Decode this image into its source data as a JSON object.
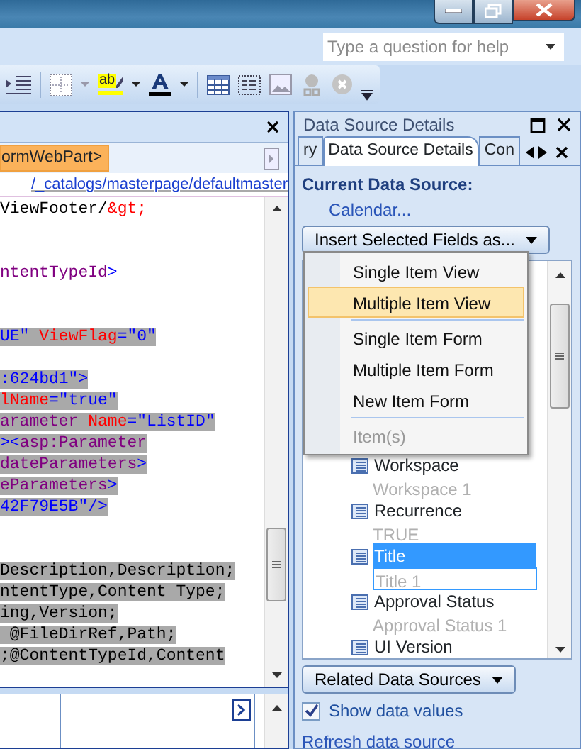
{
  "help_search": {
    "placeholder": "Type a question for help"
  },
  "toolbar": {
    "highlight_glyph": "ab"
  },
  "editor": {
    "tag_selector": "ormWebPart>",
    "path": "/_catalogs/masterpage/defaultmaster",
    "code_lines": [
      {
        "kind": "code",
        "highlighted": false,
        "tokens": [
          {
            "kind": "text",
            "text": "ViewFooter/"
          },
          {
            "kind": "entity",
            "text": "&gt;"
          }
        ]
      },
      {
        "kind": "blank"
      },
      {
        "kind": "blank"
      },
      {
        "kind": "code",
        "highlighted": false,
        "tokens": [
          {
            "kind": "element",
            "text": "ntentTypeId"
          },
          {
            "kind": "tag",
            "text": ">"
          }
        ]
      },
      {
        "kind": "blank"
      },
      {
        "kind": "blank"
      },
      {
        "kind": "code",
        "highlighted": true,
        "tokens": [
          {
            "kind": "value",
            "text": "UE\" "
          },
          {
            "kind": "attr",
            "text": "ViewFlag"
          },
          {
            "kind": "tag",
            "text": "="
          },
          {
            "kind": "value",
            "text": "\"0\""
          }
        ]
      },
      {
        "kind": "blank"
      },
      {
        "kind": "code",
        "highlighted": true,
        "tokens": [
          {
            "kind": "value",
            "text": ":624bd1\">"
          }
        ]
      },
      {
        "kind": "code",
        "highlighted": true,
        "tokens": [
          {
            "kind": "attr",
            "text": "lName"
          },
          {
            "kind": "tag",
            "text": "="
          },
          {
            "kind": "value",
            "text": "\"true\""
          }
        ]
      },
      {
        "kind": "code",
        "highlighted": true,
        "tokens": [
          {
            "kind": "element",
            "text": "arameter "
          },
          {
            "kind": "attr",
            "text": "Name"
          },
          {
            "kind": "tag",
            "text": "="
          },
          {
            "kind": "value",
            "text": "\"ListID\""
          }
        ]
      },
      {
        "kind": "code",
        "highlighted": true,
        "tokens": [
          {
            "kind": "tag",
            "text": "><"
          },
          {
            "kind": "element",
            "text": "asp:Parameter"
          }
        ]
      },
      {
        "kind": "code",
        "highlighted": true,
        "tokens": [
          {
            "kind": "element",
            "text": "dateParameters"
          },
          {
            "kind": "tag",
            "text": ">"
          }
        ]
      },
      {
        "kind": "code",
        "highlighted": true,
        "tokens": [
          {
            "kind": "element",
            "text": "eParameters"
          },
          {
            "kind": "tag",
            "text": ">"
          }
        ]
      },
      {
        "kind": "code",
        "highlighted": true,
        "tokens": [
          {
            "kind": "value",
            "text": "42F79E5B\""
          },
          {
            "kind": "tag",
            "text": "/>"
          }
        ]
      },
      {
        "kind": "blank"
      },
      {
        "kind": "blank"
      },
      {
        "kind": "code",
        "highlighted": true,
        "tokens": [
          {
            "kind": "text",
            "text": "Description,Description;"
          }
        ]
      },
      {
        "kind": "code",
        "highlighted": true,
        "tokens": [
          {
            "kind": "text",
            "text": "ntentType,Content Type;"
          }
        ]
      },
      {
        "kind": "code",
        "highlighted": true,
        "tokens": [
          {
            "kind": "text",
            "text": "ing,Version;"
          }
        ]
      },
      {
        "kind": "code",
        "highlighted": true,
        "tokens": [
          {
            "kind": "text",
            "text": " @FileDirRef,Path;"
          }
        ]
      },
      {
        "kind": "code",
        "highlighted": true,
        "tokens": [
          {
            "kind": "text",
            "text": ";@ContentTypeId,Content"
          }
        ]
      }
    ]
  },
  "panel": {
    "title": "Data Source Details",
    "tabs": [
      {
        "label": "ry",
        "selected": false
      },
      {
        "label": "Data Source Details",
        "selected": true
      },
      {
        "label": "Con",
        "selected": false
      }
    ],
    "current_source_label": "Current Data Source:",
    "current_source": "Calendar...",
    "insert_button": "Insert Selected Fields as...",
    "insert_menu": [
      {
        "kind": "item",
        "label": "Single Item View",
        "hovered": false,
        "disabled": false
      },
      {
        "kind": "item",
        "label": "Multiple Item View",
        "hovered": true,
        "disabled": false
      },
      {
        "kind": "separator"
      },
      {
        "kind": "item",
        "label": "Single Item Form",
        "hovered": false,
        "disabled": false
      },
      {
        "kind": "item",
        "label": "Multiple Item Form",
        "hovered": false,
        "disabled": false
      },
      {
        "kind": "item",
        "label": "New Item Form",
        "hovered": false,
        "disabled": false
      },
      {
        "kind": "separator"
      },
      {
        "kind": "item",
        "label": "Item(s)",
        "hovered": false,
        "disabled": true
      }
    ],
    "fields": [
      {
        "label": "Workspace",
        "value": "Workspace 1",
        "selected": false
      },
      {
        "label": "Recurrence",
        "value": "TRUE",
        "selected": false
      },
      {
        "label": "Title",
        "value": "Title 1",
        "selected": true
      },
      {
        "label": "Approval Status",
        "value": "Approval Status 1",
        "selected": false
      },
      {
        "label": "UI Version",
        "selected": false
      }
    ],
    "related_button": "Related Data Sources",
    "show_values": {
      "label": "Show data values",
      "checked": true
    },
    "refresh_link": "Refresh data source"
  }
}
